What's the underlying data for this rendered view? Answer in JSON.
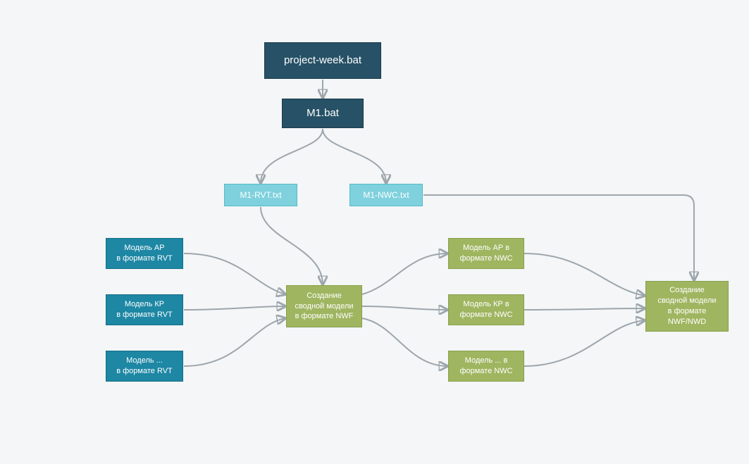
{
  "nodes": {
    "project_bat": "project-week.bat",
    "m1_bat": "M1.bat",
    "m1_rvt_txt": "M1-RVT.txt",
    "m1_nwc_txt": "M1-NWC.txt",
    "model_ar_rvt": "Модель АР\nв формате RVT",
    "model_kr_rvt": "Модель КР\nв формате RVT",
    "model_etc_rvt": "Модель ...\nв формате RVT",
    "create_nwf": "Создание\nсводной модели\nв формате NWF",
    "model_ar_nwc": "Модель АР в\nформате NWC",
    "model_kr_nwc": "Модель КР в\nформате NWC",
    "model_etc_nwc": "Модель ... в\nформате NWC",
    "create_nwf_nwd": "Создание\nсводной модели\nв формате\nNWF/NWD"
  }
}
